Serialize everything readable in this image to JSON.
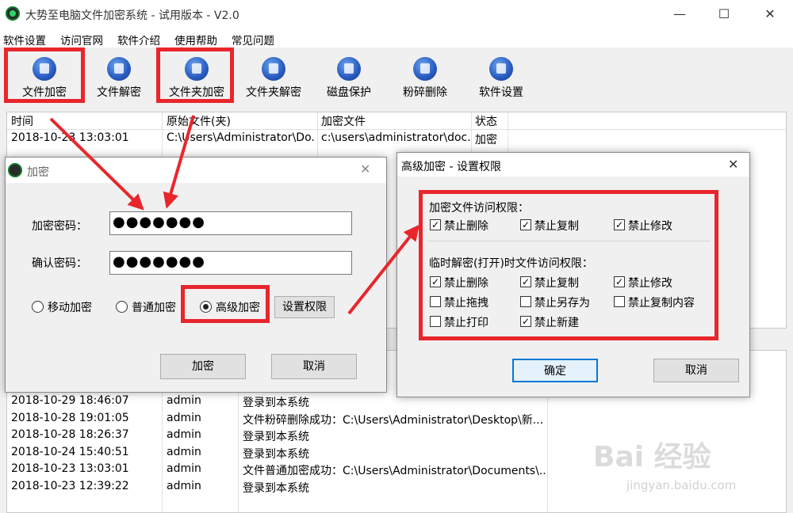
{
  "window": {
    "title": "大势至电脑文件加密系统 - 试用版本 - V2.0",
    "minimize": "—",
    "maximize": "☐",
    "close": "✕"
  },
  "menu": [
    "软件设置",
    "访问官网",
    "软件介绍",
    "使用帮助",
    "常见问题"
  ],
  "toolbar": [
    {
      "label": "文件加密",
      "icon": "file-lock-icon"
    },
    {
      "label": "文件解密",
      "icon": "file-unlock-icon"
    },
    {
      "label": "文件夹加密",
      "icon": "folder-lock-icon"
    },
    {
      "label": "文件夹解密",
      "icon": "folder-unlock-icon"
    },
    {
      "label": "磁盘保护",
      "icon": "disk-shield-icon"
    },
    {
      "label": "粉碎删除",
      "icon": "shred-icon"
    },
    {
      "label": "软件设置",
      "icon": "gear-icon"
    }
  ],
  "file_table": {
    "columns": [
      "时间",
      "原始文件(夹)",
      "加密文件",
      "状态"
    ],
    "rows": [
      [
        "2018-10-23 13:03:01",
        "C:\\Users\\Administrator\\Do...",
        "c:\\users\\administrator\\doc...",
        "加密"
      ]
    ]
  },
  "log_table": {
    "rows": [
      [
        "2018-10-29 18:46:07",
        "admin",
        "登录到本系统"
      ],
      [
        "2018-10-28 19:01:05",
        "admin",
        "文件粉碎删除成功：C:\\Users\\Administrator\\Desktop\\新..."
      ],
      [
        "2018-10-28 18:26:37",
        "admin",
        "登录到本系统"
      ],
      [
        "2018-10-24 15:40:51",
        "admin",
        "登录到本系统"
      ],
      [
        "2018-10-23 13:03:01",
        "admin",
        "文件普通加密成功：C:\\Users\\Administrator\\Documents\\..."
      ],
      [
        "2018-10-23 12:39:22",
        "admin",
        "登录到本系统"
      ]
    ]
  },
  "encrypt_dialog": {
    "title": "加密",
    "password_label": "加密密码：",
    "password_value": "●●●●●●●",
    "confirm_label": "确认密码：",
    "confirm_value": "●●●●●●●",
    "radio_options": [
      "移动加密",
      "普通加密",
      "高级加密"
    ],
    "selected": "高级加密",
    "permissions_button": "设置权限",
    "encrypt_button": "加密",
    "cancel_button": "取消",
    "close": "✕"
  },
  "perm_dialog": {
    "title": "高级加密 - 设置权限",
    "close": "✕",
    "group1_title": "加密文件访问权限：",
    "group1": [
      {
        "label": "禁止删除",
        "checked": true
      },
      {
        "label": "禁止复制",
        "checked": true
      },
      {
        "label": "禁止修改",
        "checked": true
      }
    ],
    "group2_title": "临时解密(打开)时文件访问权限：",
    "group2": [
      {
        "label": "禁止删除",
        "checked": true
      },
      {
        "label": "禁止复制",
        "checked": true
      },
      {
        "label": "禁止修改",
        "checked": true
      },
      {
        "label": "禁止拖拽",
        "checked": false
      },
      {
        "label": "禁止另存为",
        "checked": false
      },
      {
        "label": "禁止复制内容",
        "checked": false
      },
      {
        "label": "禁止打印",
        "checked": false
      },
      {
        "label": "禁止新建",
        "checked": true
      }
    ],
    "ok_button": "确定",
    "cancel_button": "取消"
  },
  "colors": {
    "highlight": "#e8262b",
    "icon_blue": "#2b5fc4",
    "focus": "#0078d7"
  },
  "watermark": {
    "logo": "Bai 经验",
    "url": "jingyan.baidu.com"
  }
}
